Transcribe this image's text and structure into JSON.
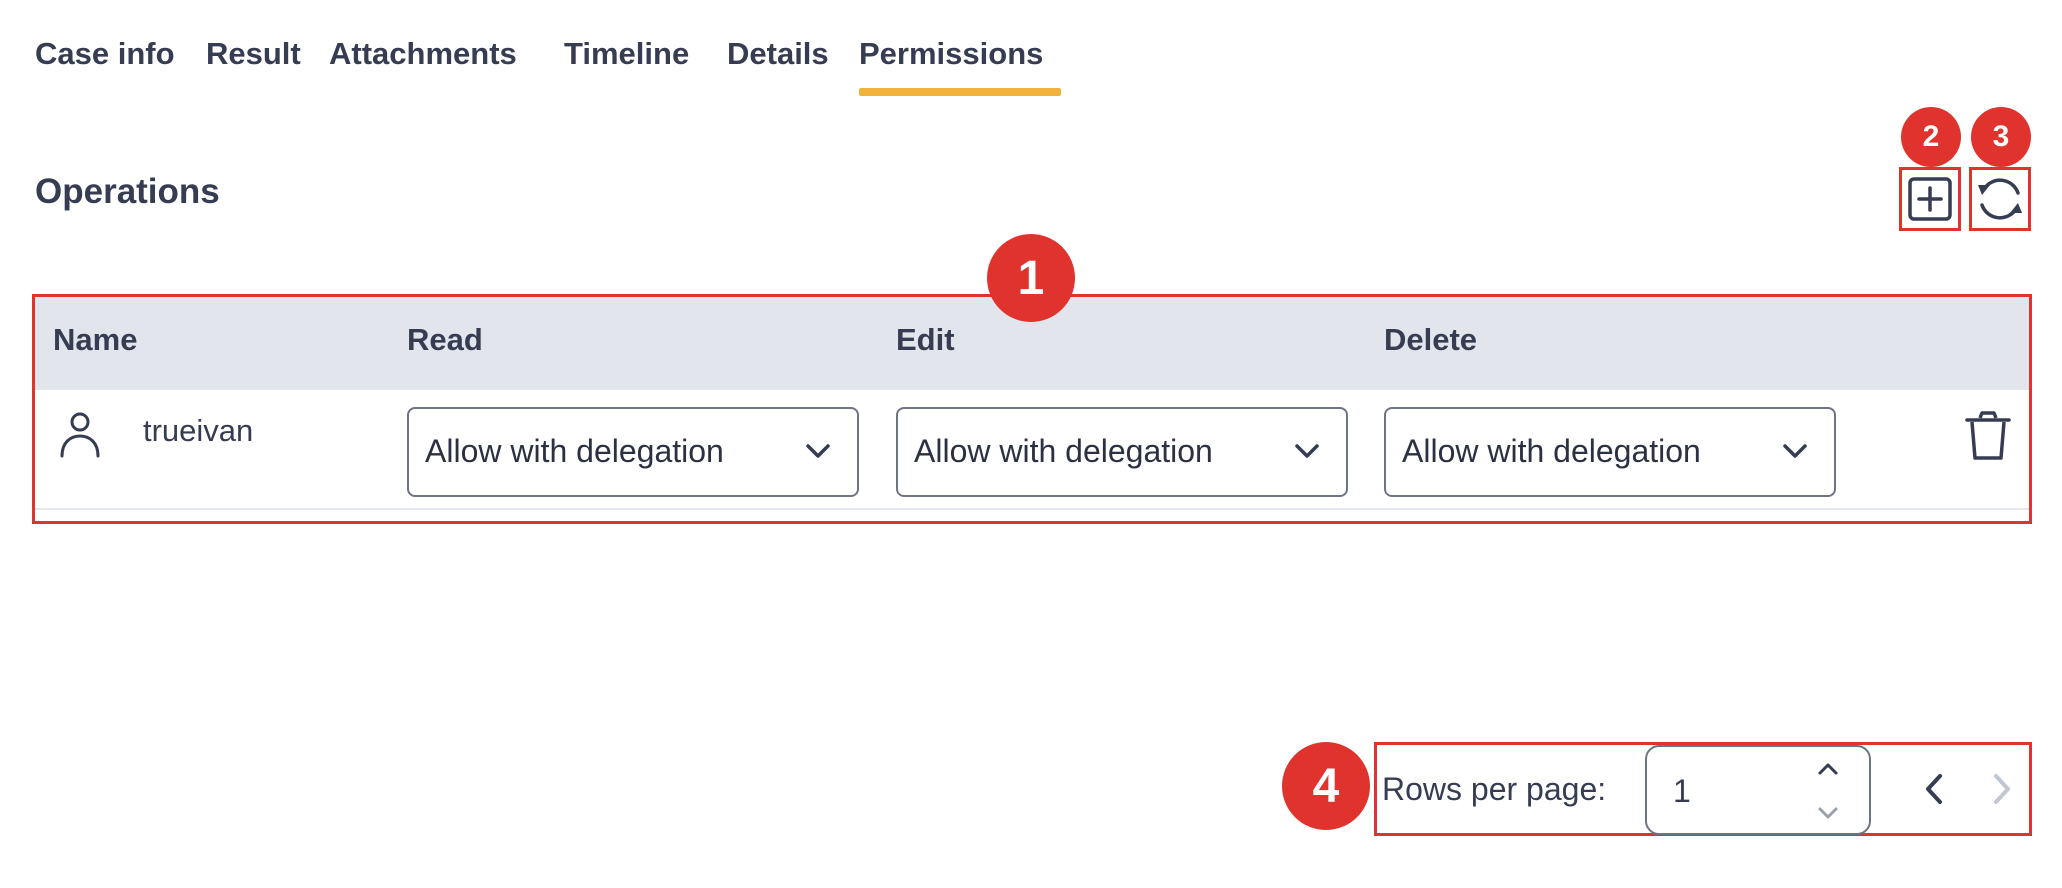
{
  "tabs": [
    {
      "label": "Case info"
    },
    {
      "label": "Result"
    },
    {
      "label": "Attachments"
    },
    {
      "label": "Timeline"
    },
    {
      "label": "Details"
    },
    {
      "label": "Permissions",
      "active": true
    }
  ],
  "section": {
    "title": "Operations"
  },
  "toolbar": {
    "add_icon": "plus-square-icon",
    "refresh_icon": "refresh-icon"
  },
  "annotations": [
    "1",
    "2",
    "3",
    "4"
  ],
  "table": {
    "columns": [
      "Name",
      "Read",
      "Edit",
      "Delete"
    ],
    "rows": [
      {
        "name": "trueivan",
        "read": "Allow with delegation",
        "edit": "Allow with delegation",
        "delete": "Allow with delegation"
      }
    ]
  },
  "pagination": {
    "rows_label": "Rows per page:",
    "rows_value": "1"
  },
  "colors": {
    "accent": "#f0b43c",
    "annotation": "#e0332d",
    "text": "#363c52",
    "header_bg": "#e3e5ed"
  }
}
